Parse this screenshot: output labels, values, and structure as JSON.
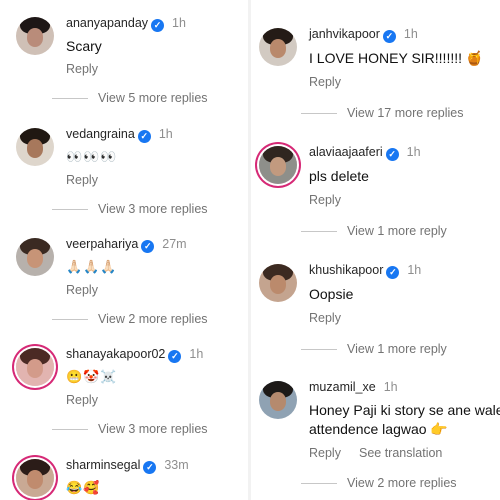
{
  "left": [
    {
      "username": "ananyapanday",
      "time": "1h",
      "text": "Scary",
      "reply": "Reply",
      "more": "View 5 more replies",
      "colors": [
        "#cfc0b6",
        "#b98c7a",
        "#1d1716"
      ]
    },
    {
      "username": "vedangraina",
      "time": "1h",
      "text": "👀👀👀",
      "reply": "Reply",
      "more": "View 3 more replies",
      "colors": [
        "#ded6cc",
        "#a7785c",
        "#201812"
      ]
    },
    {
      "username": "veerpahariya",
      "time": "27m",
      "text": "🙏🏻🙏🏻🙏🏻",
      "reply": "Reply",
      "more": "View 2 more replies",
      "colors": [
        "#b7b1ac",
        "#c79477",
        "#3a2a22"
      ]
    },
    {
      "username": "shanayakapoor02",
      "time": "1h",
      "text": "😬🤡☠️",
      "reply": "Reply",
      "more": "View 3 more replies",
      "colors": [
        "#e2b4b0",
        "#d39b8a",
        "#4b2a24"
      ]
    },
    {
      "username": "sharminsegal",
      "time": "33m",
      "text": "😂🥰",
      "colors": [
        "#c9a994",
        "#c08b6e",
        "#2b1c18"
      ]
    }
  ],
  "right": [
    {
      "username": "janhvikapoor",
      "time": "1h",
      "text": "I LOVE HONEY SIR!!!!!!! 🍯",
      "reply": "Reply",
      "more": "View 17 more replies",
      "colors": [
        "#d2cac2",
        "#b9896c",
        "#241b16"
      ]
    },
    {
      "username": "alaviaajaaferi",
      "time": "1h",
      "text": "pls delete",
      "reply": "Reply",
      "more": "View 1 more reply",
      "colors": [
        "#8e8f8a",
        "#c29a7f",
        "#302620"
      ]
    },
    {
      "username": "khushikapoor",
      "time": "1h",
      "text": "Oopsie",
      "reply": "Reply",
      "more": "View 1 more reply",
      "colors": [
        "#c4a48f",
        "#bb8a6c",
        "#3c2a21"
      ]
    },
    {
      "username": "muzamil_xe",
      "time": "1h",
      "text": "Honey Paji ki story se ane wale attendence lagwao 👉",
      "reply": "Reply",
      "translate": "See translation",
      "more": "View 2 more replies",
      "colors": [
        "#8fa2b3",
        "#b58a6e",
        "#1d1a18"
      ]
    }
  ],
  "verified_color": "#1877f2",
  "story_ring_color": "#d62976"
}
